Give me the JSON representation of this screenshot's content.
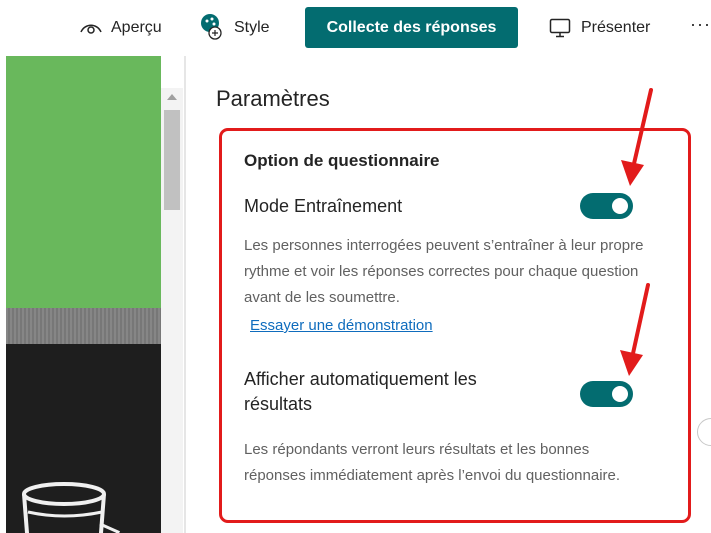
{
  "toolbar": {
    "preview_label": "Aperçu",
    "style_label": "Style",
    "collect_label": "Collecte des réponses",
    "present_label": "Présenter",
    "more_label": "···"
  },
  "settings": {
    "title": "Paramètres",
    "section_title": "Option de questionnaire",
    "practice_mode": {
      "label": "Mode Entraînement",
      "enabled": true,
      "description": "Les personnes interrogées peuvent s’entraîner à leur propre rythme et voir les réponses correctes pour chaque question avant de les soumettre.",
      "demo_link": "Essayer une démonstration"
    },
    "auto_results": {
      "label": "Afficher automatiquement les résultats",
      "enabled": true,
      "description": "Les répondants verront leurs résultats et les bonnes réponses immédiatement après l’envoi du questionnaire."
    }
  },
  "icons": {
    "preview": "eye-icon",
    "style": "palette-icon",
    "present": "monitor-icon",
    "more": "more-icon"
  },
  "colors": {
    "accent": "#036c70",
    "annotation": "#e21b1b",
    "link": "#0f6cbd",
    "preview_green": "#69b85c"
  }
}
